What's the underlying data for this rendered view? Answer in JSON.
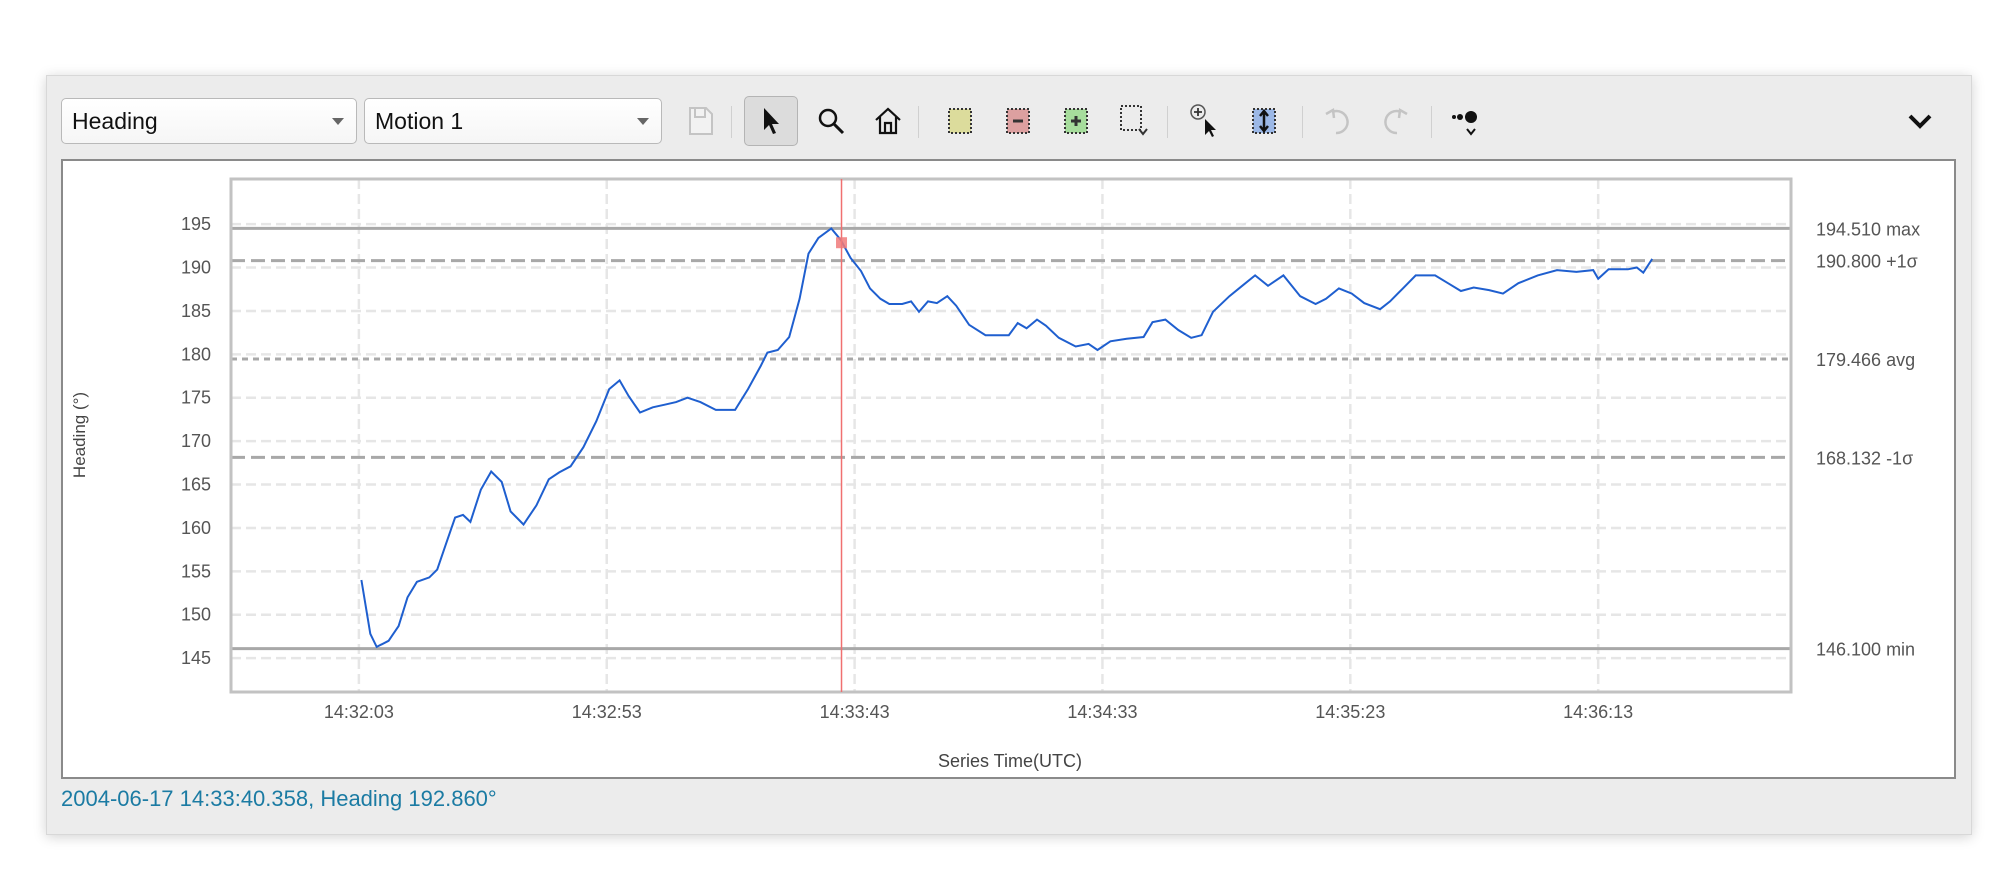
{
  "toolbar": {
    "field_select": "Heading",
    "series_select": "Motion 1",
    "icons": [
      "save-icon",
      "pointer-icon",
      "zoom-icon",
      "home-icon",
      "select-region-yellow-icon",
      "remove-region-icon",
      "add-region-icon",
      "region-dropdown-icon",
      "zoom-cursor-icon",
      "fit-vertical-icon",
      "undo-icon",
      "redo-icon",
      "marker-style-icon",
      "collapse-chevron-icon"
    ]
  },
  "status": "2004-06-17 14:33:40.358, Heading 192.860°",
  "colors": {
    "series": "#1f5fcf",
    "cursor": "#f07070",
    "stat_line": "#a8a8a8",
    "status_text": "#1b7ba3"
  },
  "chart_data": {
    "type": "line",
    "title": "",
    "xlabel": "Series Time(UTC)",
    "ylabel": "Heading (°)",
    "x_units": "seconds after 14:32:03",
    "xlim": [
      -25.8,
      288.9
    ],
    "ylim": [
      141.1,
      200.2
    ],
    "x_ticks": [
      {
        "value": 0,
        "label": "14:32:03"
      },
      {
        "value": 50,
        "label": "14:32:53"
      },
      {
        "value": 100,
        "label": "14:33:43"
      },
      {
        "value": 150,
        "label": "14:34:33"
      },
      {
        "value": 200,
        "label": "14:35:23"
      },
      {
        "value": 250,
        "label": "14:36:13"
      }
    ],
    "y_ticks": [
      145,
      150,
      155,
      160,
      165,
      170,
      175,
      180,
      185,
      190,
      195
    ],
    "grid": true,
    "stat_lines": [
      {
        "value": 194.51,
        "label": "194.510 max",
        "style": "solid"
      },
      {
        "value": 190.8,
        "label": "190.800 +1σ",
        "style": "dashed"
      },
      {
        "value": 179.466,
        "label": "179.466 avg",
        "style": "dotted"
      },
      {
        "value": 168.132,
        "label": "168.132 -1σ",
        "style": "dashed"
      },
      {
        "value": 146.1,
        "label": "146.100 min",
        "style": "solid"
      }
    ],
    "cursor": {
      "x": 97.36,
      "y": 192.86
    },
    "series": [
      {
        "name": "Heading",
        "x": [
          0.5,
          2.3,
          3.6,
          6,
          8,
          9.8,
          11.7,
          14.2,
          15.8,
          17.6,
          19.4,
          21,
          22.5,
          24.6,
          26.7,
          28.8,
          30.6,
          33.2,
          35.8,
          38.3,
          40.4,
          42.7,
          45.3,
          47.9,
          50.5,
          52.6,
          54.4,
          56.7,
          59.3,
          61.7,
          64,
          66.3,
          68.9,
          72,
          75.9,
          78.5,
          81.1,
          82.4,
          84.5,
          86.8,
          88.9,
          90.7,
          92.7,
          95.3,
          97.2,
          99.2,
          101.3,
          103.1,
          105.2,
          107,
          109.6,
          111.4,
          113,
          114.8,
          116.6,
          118.7,
          120.5,
          123.1,
          126.4,
          131.1,
          132.9,
          134.7,
          136.8,
          138.6,
          141.2,
          144.6,
          147.2,
          149,
          151.6,
          154.9,
          158.3,
          160.1,
          162.7,
          165.3,
          167.9,
          170,
          172.3,
          175.6,
          178.2,
          180.8,
          183.4,
          186.5,
          189.9,
          193,
          195.1,
          197.7,
          200.3,
          202.8,
          206,
          208,
          210.6,
          213.2,
          217.1,
          219.7,
          222.3,
          224.9,
          228,
          230.8,
          233.9,
          237.8,
          241.7,
          245.6,
          249,
          250,
          252.1,
          256,
          257.8,
          259.1,
          260.9
        ],
        "y": [
          154,
          147.8,
          146.3,
          147,
          148.7,
          152,
          153.8,
          154.3,
          155.2,
          158.2,
          161.2,
          161.5,
          160.7,
          164.4,
          166.5,
          165.3,
          161.9,
          160.4,
          162.6,
          165.6,
          166.4,
          167.1,
          169.3,
          172.3,
          176,
          177,
          175.2,
          173.3,
          173.9,
          174.2,
          174.5,
          175,
          174.5,
          173.6,
          173.6,
          176,
          178.7,
          180.2,
          180.5,
          182,
          186.4,
          191.6,
          193.4,
          194.5,
          193.2,
          191.1,
          189.6,
          187.6,
          186.4,
          185.8,
          185.8,
          186.1,
          184.9,
          186.1,
          185.9,
          186.7,
          185.6,
          183.4,
          182.2,
          182.2,
          183.6,
          183,
          184,
          183.3,
          181.9,
          180.9,
          181.2,
          180.5,
          181.5,
          181.8,
          182,
          183.7,
          184,
          182.8,
          181.9,
          182.2,
          184.9,
          186.7,
          187.9,
          189.1,
          187.9,
          189.1,
          186.7,
          185.8,
          186.4,
          187.6,
          187,
          185.9,
          185.2,
          186.1,
          187.6,
          189.1,
          189.1,
          188.2,
          187.3,
          187.7,
          187.4,
          187,
          188.2,
          189.1,
          189.7,
          189.5,
          189.7,
          188.7,
          189.8,
          189.8,
          190,
          189.4,
          191
        ]
      }
    ]
  }
}
